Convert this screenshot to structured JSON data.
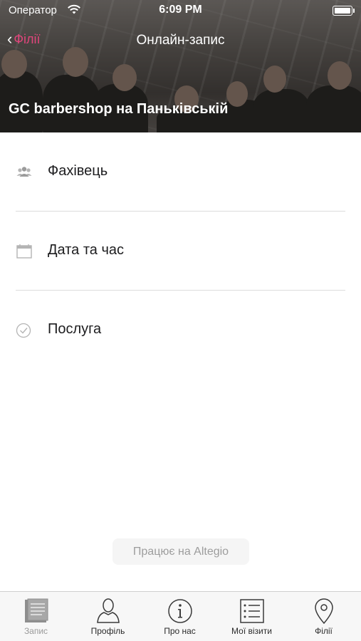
{
  "status_bar": {
    "carrier": "Оператор",
    "time": "6:09 PM"
  },
  "header": {
    "back_label": "Філії",
    "title": "Онлайн-запис",
    "branch_name": "GC barbershop на Паньківській"
  },
  "menu": {
    "items": [
      {
        "label": "Фахівець",
        "icon": "people-icon"
      },
      {
        "label": "Дата та час",
        "icon": "calendar-icon"
      },
      {
        "label": "Послуга",
        "icon": "check-circle-icon"
      }
    ]
  },
  "powered_by": "Працює на Altegio",
  "tabbar": {
    "items": [
      {
        "label": "Запис",
        "icon": "document-icon",
        "active": true
      },
      {
        "label": "Профіль",
        "icon": "person-icon",
        "active": false
      },
      {
        "label": "Про нас",
        "icon": "info-icon",
        "active": false
      },
      {
        "label": "Мої візити",
        "icon": "list-icon",
        "active": false
      },
      {
        "label": "Філії",
        "icon": "location-pin-icon",
        "active": false
      }
    ]
  },
  "colors": {
    "accent": "#e0457b",
    "tab_active": "#9a9a9a"
  }
}
